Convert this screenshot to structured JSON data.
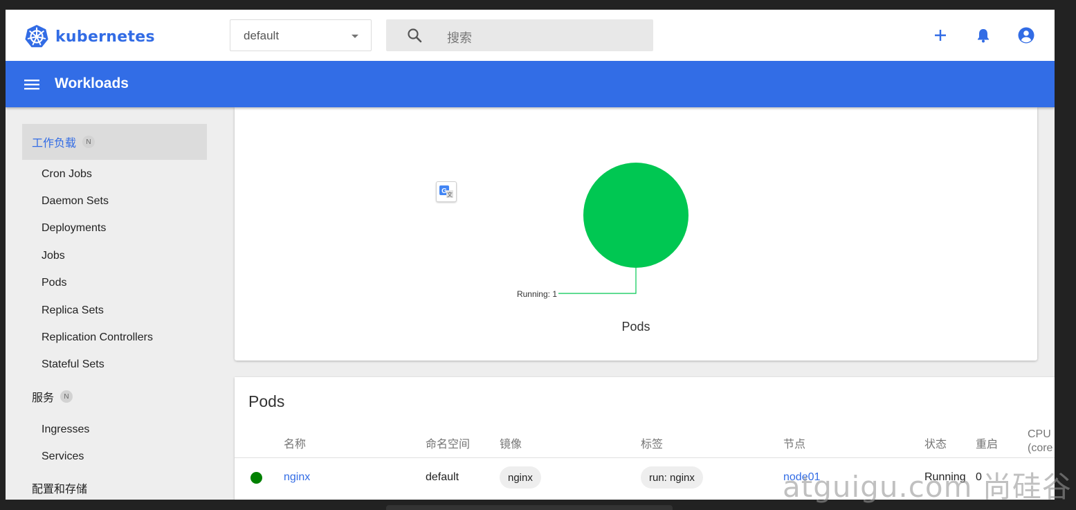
{
  "brand": {
    "name": "kubernetes"
  },
  "toolbar": {
    "namespace": "default",
    "search_placeholder": "搜索",
    "icons": [
      "add-icon",
      "notifications-bell-icon",
      "account-circle-icon"
    ]
  },
  "titlebar": {
    "title": "Workloads"
  },
  "sidebar": {
    "categories": [
      {
        "label": "工作负载",
        "badge": "N",
        "active": true
      },
      {
        "label": "服务",
        "badge": "N"
      },
      {
        "label": "配置和存储"
      }
    ],
    "workloads_items": [
      "Cron Jobs",
      "Daemon Sets",
      "Deployments",
      "Jobs",
      "Pods",
      "Replica Sets",
      "Replication Controllers",
      "Stateful Sets"
    ],
    "services_items": [
      "Ingresses",
      "Services"
    ]
  },
  "chart_data": {
    "type": "pie",
    "title": "Pods",
    "slices": [
      {
        "label": "Running",
        "value": 1,
        "color": "#00c752"
      }
    ],
    "annotation": "Running: 1"
  },
  "pods": {
    "title": "Pods",
    "columns": [
      "名称",
      "命名空间",
      "镜像",
      "标签",
      "节点",
      "状态",
      "重启",
      "CPU\n(core"
    ],
    "rows": [
      {
        "status_color": "#008000",
        "name": "nginx",
        "namespace": "default",
        "image": "nginx",
        "labels": "run: nginx",
        "node": "node01",
        "status": "Running",
        "restarts": "0"
      }
    ]
  },
  "watermark": "atguigu.com 尚硅谷"
}
